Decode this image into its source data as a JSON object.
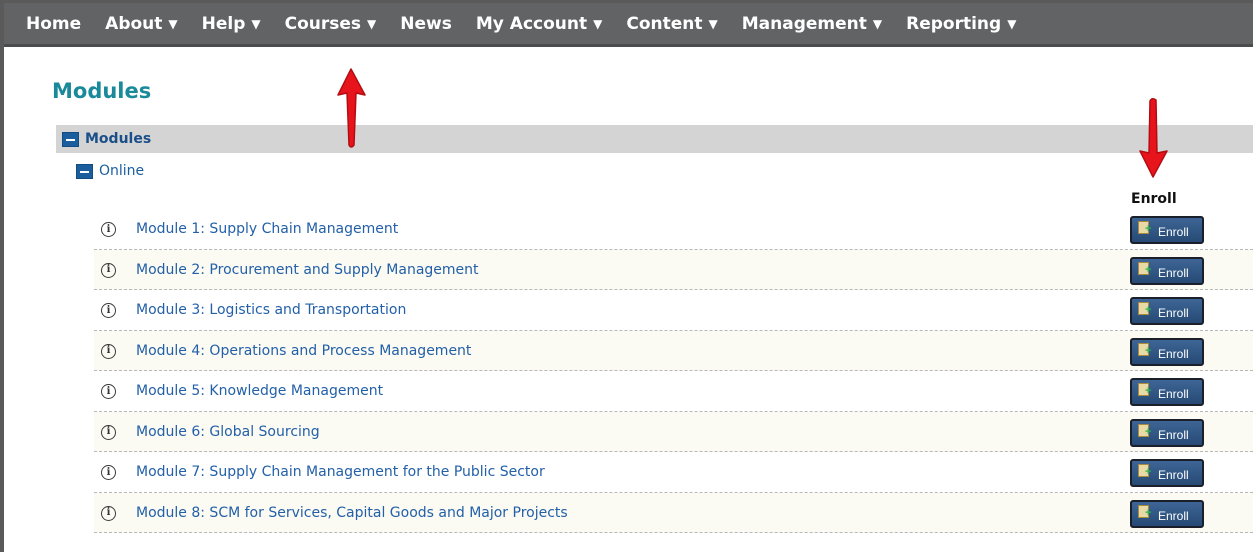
{
  "nav": {
    "items": [
      {
        "label": "Home",
        "dropdown": false
      },
      {
        "label": "About",
        "dropdown": true
      },
      {
        "label": "Help",
        "dropdown": true
      },
      {
        "label": "Courses",
        "dropdown": true
      },
      {
        "label": "News",
        "dropdown": false
      },
      {
        "label": "My Account",
        "dropdown": true
      },
      {
        "label": "Content",
        "dropdown": true
      },
      {
        "label": "Management",
        "dropdown": true
      },
      {
        "label": "Reporting",
        "dropdown": true
      }
    ],
    "caret": "▼"
  },
  "page": {
    "title": "Modules",
    "section_label": "Modules",
    "subgroup_label": "Online",
    "enroll_header": "Enroll",
    "info_glyph": "i"
  },
  "modules": [
    {
      "title": "Module 1: Supply Chain Management",
      "button_label": "Enroll"
    },
    {
      "title": "Module 2: Procurement and Supply Management",
      "button_label": "Enroll"
    },
    {
      "title": "Module 3: Logistics and Transportation",
      "button_label": "Enroll"
    },
    {
      "title": "Module 4: Operations and Process Management",
      "button_label": "Enroll"
    },
    {
      "title": "Module 5: Knowledge Management",
      "button_label": "Enroll"
    },
    {
      "title": "Module 6: Global Sourcing",
      "button_label": "Enroll"
    },
    {
      "title": "Module 7: Supply Chain Management for the Public Sector",
      "button_label": "Enroll"
    },
    {
      "title": "Module 8: SCM for Services, Capital Goods and Major Projects",
      "button_label": "Enroll"
    }
  ],
  "colors": {
    "nav_bg": "#616365",
    "title_teal": "#1a8a9a",
    "link_blue": "#2360a8",
    "button_blue": "#3d6595",
    "annotation_red": "#e8141b"
  }
}
